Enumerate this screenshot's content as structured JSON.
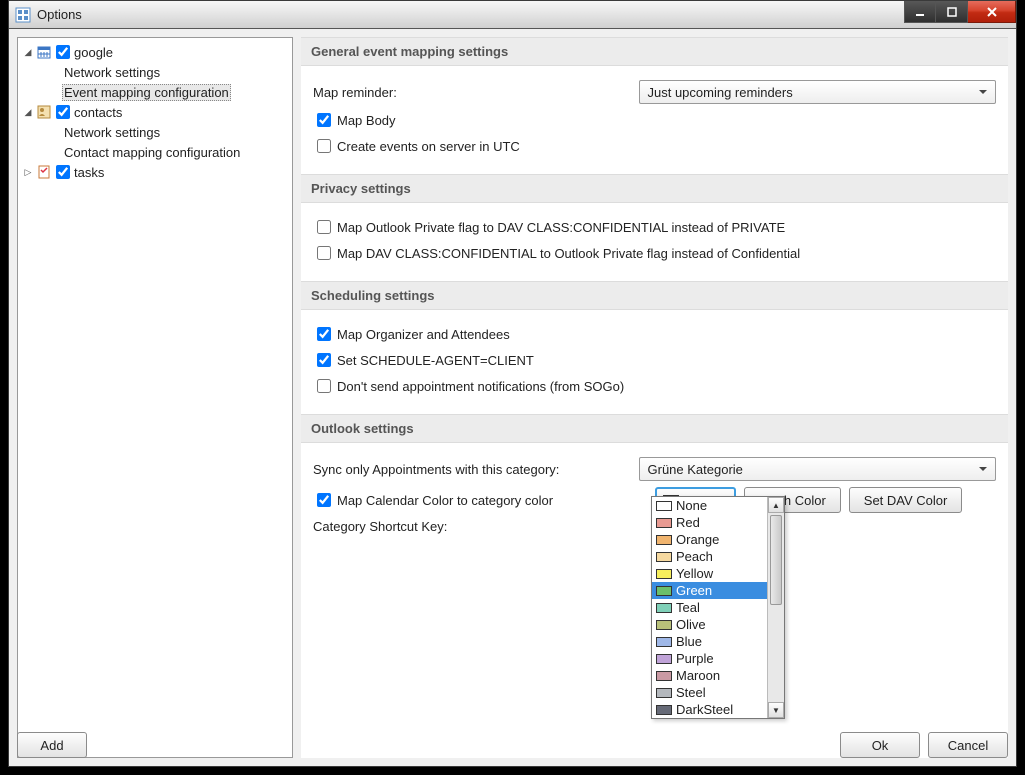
{
  "window": {
    "title": "Options"
  },
  "tree": {
    "google": {
      "label": "google",
      "children": [
        "Network settings",
        "Event mapping configuration"
      ]
    },
    "contacts": {
      "label": "contacts",
      "children": [
        "Network settings",
        "Contact mapping configuration"
      ]
    },
    "tasks": {
      "label": "tasks"
    }
  },
  "sections": {
    "general": {
      "title": "General event mapping settings",
      "map_reminder_label": "Map reminder:",
      "map_reminder_value": "Just upcoming reminders",
      "map_body": "Map Body",
      "create_utc": "Create events on server in UTC"
    },
    "privacy": {
      "title": "Privacy settings",
      "opt1": "Map Outlook Private flag to DAV CLASS:CONFIDENTIAL instead of PRIVATE",
      "opt2": "Map DAV CLASS:CONFIDENTIAL to Outlook Private flag instead of Confidential"
    },
    "scheduling": {
      "title": "Scheduling settings",
      "opt1": "Map Organizer and Attendees",
      "opt2": "Set SCHEDULE-AGENT=CLIENT",
      "opt3": "Don't send appointment notifications (from SOGo)"
    },
    "outlook": {
      "title": "Outlook settings",
      "sync_label": "Sync only Appointments with this category:",
      "sync_value": "Grüne Kategorie",
      "map_color": "Map Calendar Color to category color",
      "shortcut_label": "Category Shortcut Key:",
      "color_btn_label": "None",
      "fetch_color": "Fetch Color",
      "set_dav_color": "Set DAV Color"
    }
  },
  "colors": {
    "options": [
      {
        "name": "None",
        "hex": "#ffffff"
      },
      {
        "name": "Red",
        "hex": "#e89a92"
      },
      {
        "name": "Orange",
        "hex": "#f0b46e"
      },
      {
        "name": "Peach",
        "hex": "#f6d9a0"
      },
      {
        "name": "Yellow",
        "hex": "#f7ef5c"
      },
      {
        "name": "Green",
        "hex": "#6bbf6b"
      },
      {
        "name": "Teal",
        "hex": "#7fd0b8"
      },
      {
        "name": "Olive",
        "hex": "#b9c17a"
      },
      {
        "name": "Blue",
        "hex": "#9fb8e8"
      },
      {
        "name": "Purple",
        "hex": "#c0a3d8"
      },
      {
        "name": "Maroon",
        "hex": "#ca9aa4"
      },
      {
        "name": "Steel",
        "hex": "#b4b8bd"
      },
      {
        "name": "DarkSteel",
        "hex": "#666a77"
      }
    ],
    "selected": "Green"
  },
  "buttons": {
    "add": "Add",
    "ok": "Ok",
    "cancel": "Cancel"
  }
}
